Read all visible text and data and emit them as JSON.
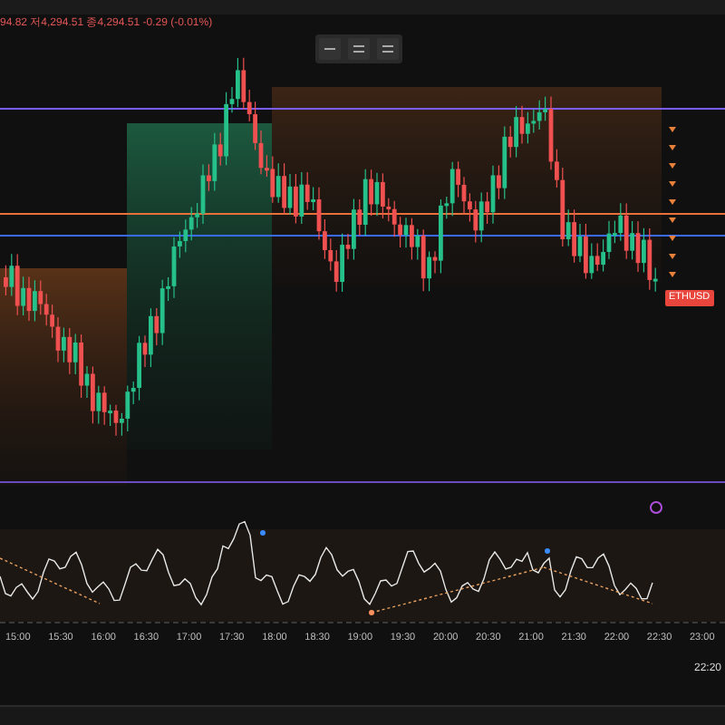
{
  "legend": {
    "quote": "94.82 저4,294.51 종4,294.51 -0.29 (-0.01%)"
  },
  "price_tag": {
    "label": "ETHUSD"
  },
  "time_axis": {
    "labels": [
      "15:00",
      "15:30",
      "16:00",
      "16:30",
      "17:00",
      "17:30",
      "18:00",
      "18:30",
      "19:00",
      "19:30",
      "20:00",
      "20:30",
      "21:00",
      "21:30",
      "22:00",
      "22:30",
      "23:00"
    ]
  },
  "crosshair_time": "22:20"
}
